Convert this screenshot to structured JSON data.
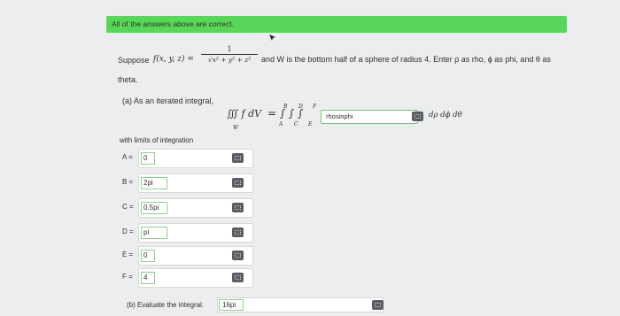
{
  "banner": {
    "text": "All of the answers above are correct."
  },
  "problem": {
    "suppose": "Suppose",
    "function_lhs": "f(x, y, z) =",
    "frac_num": "1",
    "frac_den": "x² + y² + z²",
    "statement": "and W is the bottom half of a sphere of radius 4. Enter ρ as rho, ϕ as phi, and θ as",
    "statement_cont": "theta."
  },
  "part_a": {
    "label": "(a) As an iterated integral,",
    "integral_lhs": "∭ f dV",
    "integral_sub": "W",
    "integral_rhs": "= ∫ ∫ ∫",
    "limits_labels": {
      "upper_outer": "B",
      "upper_mid": "D",
      "upper_inner": "F",
      "lower_outer": "A",
      "lower_mid": "C",
      "lower_inner": "E"
    },
    "integrand_value": "rhosinphi",
    "differentials": "dρ dϕ dθ",
    "limits_heading": "with limits of integration",
    "limits": [
      {
        "label": "A =",
        "value": "0"
      },
      {
        "label": "B =",
        "value": "2pi"
      },
      {
        "label": "C =",
        "value": "0.5pi"
      },
      {
        "label": "D =",
        "value": "pi"
      },
      {
        "label": "E =",
        "value": "0"
      },
      {
        "label": "F =",
        "value": "4"
      }
    ]
  },
  "part_b": {
    "label": "(b) Evaluate the integral.",
    "value": "16pi"
  },
  "colors": {
    "correct_banner": "#59d65a",
    "input_border": "#8fce8f"
  },
  "icons": {
    "keyboard": "keyboard-icon",
    "cursor": "mouse-cursor-icon"
  }
}
